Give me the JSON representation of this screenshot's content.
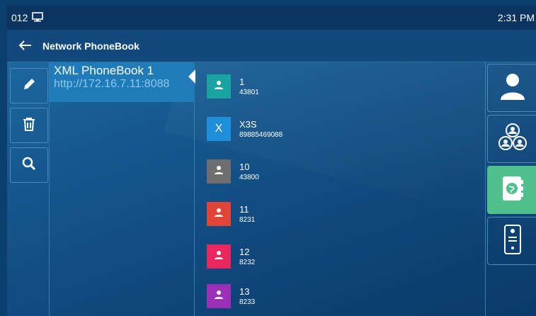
{
  "statusbar": {
    "extension": "012",
    "time": "2:31 PM"
  },
  "header": {
    "title": "Network PhoneBook"
  },
  "group": {
    "name": "XML PhoneBook 1",
    "url": "http://172.16.7.11:8088"
  },
  "contacts": [
    {
      "name": "1",
      "number": "43801",
      "color": "#1aa3a3",
      "avatar": "person-icon"
    },
    {
      "name": "X3S",
      "number": "89885469088",
      "color": "#1e8fd8",
      "avatar": "X"
    },
    {
      "name": "10",
      "number": "43800",
      "color": "#6e6e6e",
      "avatar": "person-icon"
    },
    {
      "name": "11",
      "number": "8231",
      "color": "#e24536",
      "avatar": "person-icon"
    },
    {
      "name": "12",
      "number": "8232",
      "color": "#e8275e",
      "avatar": "person-icon"
    },
    {
      "name": "13",
      "number": "8233",
      "color": "#9b2fb5",
      "avatar": "person-icon"
    }
  ],
  "tabs": [
    "local-directory-icon",
    "group-icon",
    "network-phonebook-icon",
    "door-phone-icon"
  ],
  "tools": [
    "pencil-icon",
    "trash-icon",
    "search-icon"
  ]
}
